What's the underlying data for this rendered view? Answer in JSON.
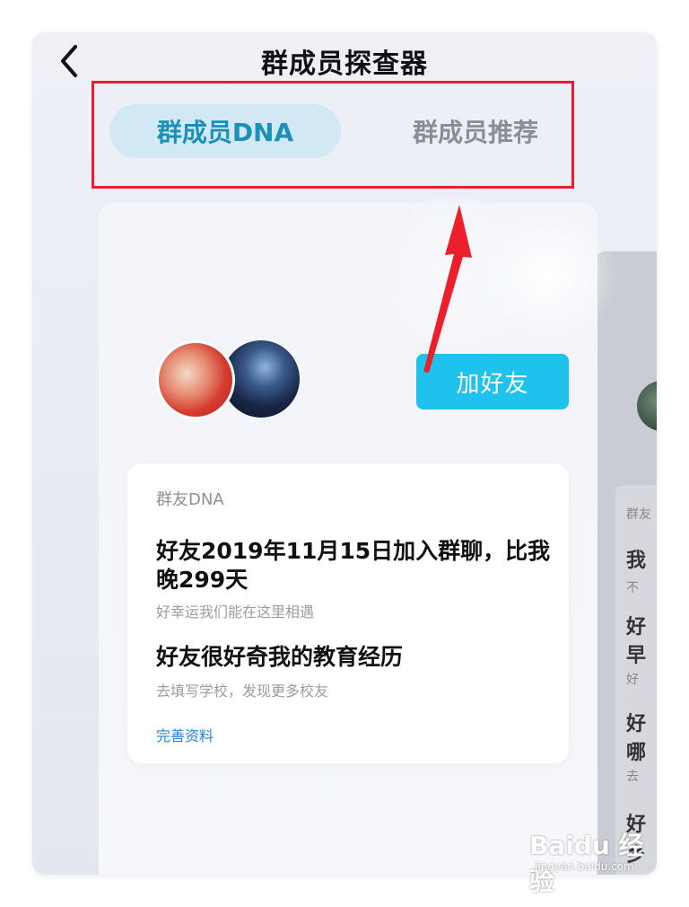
{
  "header": {
    "title": "群成员探查器"
  },
  "tabs": [
    {
      "label": "群成员DNA",
      "active": true
    },
    {
      "label": "群成员推荐",
      "active": false
    }
  ],
  "profile": {
    "add_friend_label": "加好友"
  },
  "dna_card": {
    "label": "群友DNA",
    "items": [
      {
        "title": "好友2019年11月15日加入群聊，比我晚299天",
        "subtitle": "好幸运我们能在这里相遇"
      },
      {
        "title": "好友很好奇我的教育经历",
        "subtitle": "去填写学校，发现更多校友"
      }
    ],
    "link": "完善资料"
  },
  "side_card": {
    "label": "群友",
    "lines": [
      "我",
      "不",
      "好",
      "早",
      "好",
      "好",
      "哪",
      "去",
      "好",
      "乡"
    ]
  },
  "watermark": {
    "logo": "Baidu 经验",
    "url": "jingyan.baidu.com"
  },
  "colors": {
    "accent": "#1fc2ec",
    "tab_active_bg": "#d2e8f4",
    "tab_active_text": "#1b90b9",
    "highlight_box": "#ee1c2c",
    "link": "#2a7fd8"
  },
  "icons": {
    "back": "chevron-left-icon",
    "annotation": "red-arrow-icon"
  }
}
